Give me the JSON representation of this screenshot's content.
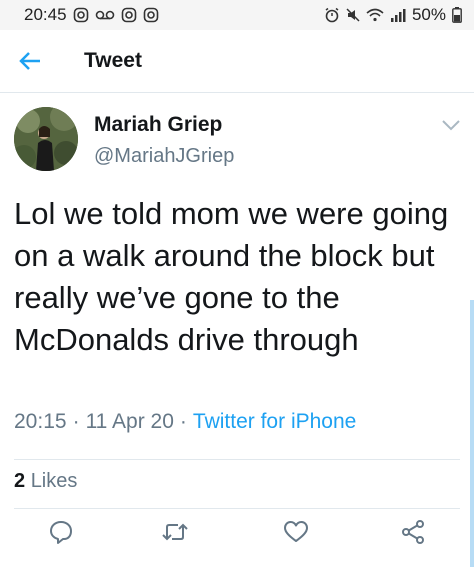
{
  "status_bar": {
    "time": "20:45",
    "battery": "50%",
    "left_icons": [
      "instagram-icon",
      "voicemail-icon",
      "instagram-icon",
      "instagram-icon"
    ],
    "right_icons": [
      "alarm-icon",
      "mute-icon",
      "wifi-icon",
      "signal-icon",
      "battery-icon"
    ]
  },
  "header": {
    "back_icon": "arrow-left-icon",
    "title": "Tweet",
    "accent_color": "#1da1f2"
  },
  "tweet": {
    "author_name": "Mariah Griep",
    "author_handle": "@MariahJGriep",
    "text": "Lol we told mom we were going on a walk around the block but really we’ve gone to the McDonalds drive through",
    "time": "20:15",
    "separator": "·",
    "date": "11 Apr 20",
    "source": "Twitter for iPhone",
    "likes_count": "2",
    "likes_label": "Likes"
  },
  "actions": [
    "reply-icon",
    "retweet-icon",
    "like-icon",
    "share-icon"
  ],
  "colors": {
    "text": "#14171a",
    "secondary": "#657786",
    "link": "#1da1f2",
    "divider": "#e1e8ed"
  }
}
